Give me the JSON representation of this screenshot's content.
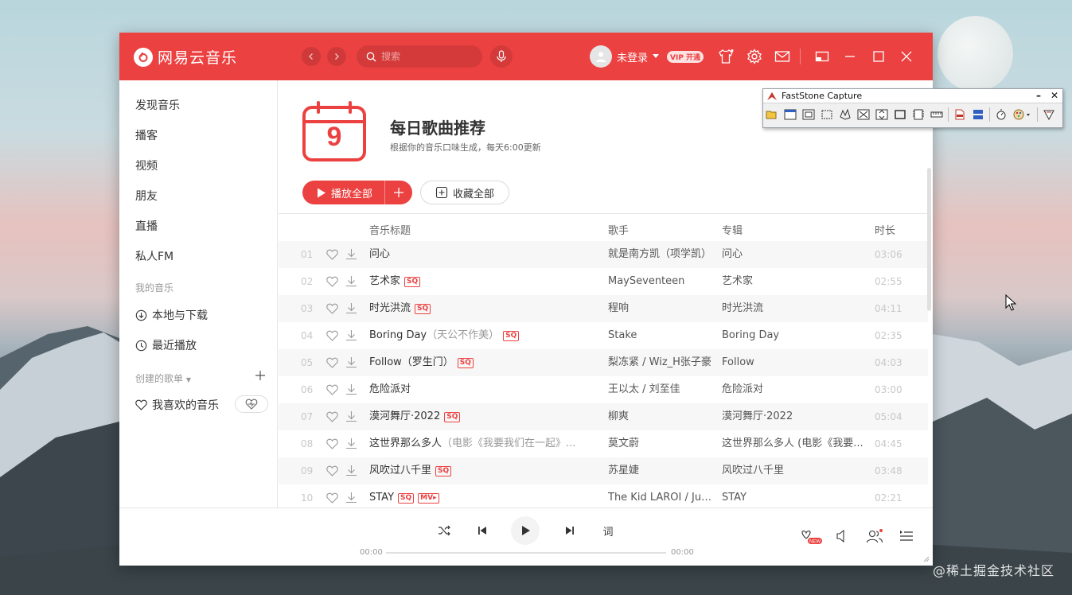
{
  "app": {
    "name": "网易云音乐",
    "search_placeholder": "搜索",
    "user_name": "未登录",
    "vip_label": "VIP 开通"
  },
  "sidebar": {
    "items": [
      "发现音乐",
      "播客",
      "视频",
      "朋友",
      "直播",
      "私人FM"
    ],
    "my_music_header": "我的音乐",
    "my_music_items": [
      "本地与下载",
      "最近播放"
    ],
    "created_header": "创建的歌单",
    "liked_playlist": "我喜欢的音乐"
  },
  "daily": {
    "calendar_day": "9",
    "title": "每日歌曲推荐",
    "subtitle": "根据你的音乐口味生成，每天6:00更新",
    "play_all": "播放全部",
    "collect_all": "收藏全部"
  },
  "table": {
    "headers": {
      "title": "音乐标题",
      "artist": "歌手",
      "album": "专辑",
      "duration": "时长"
    },
    "rows": [
      {
        "idx": "01",
        "title": "问心",
        "alias": "",
        "sq": false,
        "mv": false,
        "artist": "就是南方凯（项学凯）",
        "album": "问心",
        "duration": "03:06"
      },
      {
        "idx": "02",
        "title": "艺术家",
        "alias": "",
        "sq": true,
        "mv": false,
        "artist": "MaySeventeen",
        "album": "艺术家",
        "duration": "02:55"
      },
      {
        "idx": "03",
        "title": "时光洪流",
        "alias": "",
        "sq": true,
        "mv": false,
        "artist": "程响",
        "album": "时光洪流",
        "duration": "04:11"
      },
      {
        "idx": "04",
        "title": "Boring Day",
        "alias": "（天公不作美）",
        "sq": true,
        "mv": false,
        "artist": "Stake",
        "album": "Boring Day",
        "duration": "02:35"
      },
      {
        "idx": "05",
        "title": "Follow（罗生门）",
        "alias": "",
        "sq": true,
        "mv": false,
        "artist": "梨冻紧 / Wiz_H张子豪",
        "album": "Follow",
        "duration": "04:03"
      },
      {
        "idx": "06",
        "title": "危险派对",
        "alias": "",
        "sq": false,
        "mv": false,
        "artist": "王以太 / 刘至佳",
        "album": "危险派对",
        "duration": "03:00"
      },
      {
        "idx": "07",
        "title": "漠河舞厅·2022",
        "alias": "",
        "sq": true,
        "mv": false,
        "artist": "柳爽",
        "album": "漠河舞厅·2022",
        "duration": "05:04"
      },
      {
        "idx": "08",
        "title": "这世界那么多人",
        "alias": "（电影《我要我们在一起》...",
        "sq": false,
        "mv": true,
        "artist": "莫文蔚",
        "album": "这世界那么多人 (电影《我要...",
        "duration": "04:45"
      },
      {
        "idx": "09",
        "title": "风吹过八千里",
        "alias": "",
        "sq": true,
        "mv": false,
        "artist": "苏星婕",
        "album": "风吹过八千里",
        "duration": "03:48"
      },
      {
        "idx": "10",
        "title": "STAY",
        "alias": "",
        "sq": true,
        "mv": true,
        "artist": "The Kid LAROI / Just...",
        "album": "STAY",
        "duration": "02:21"
      }
    ],
    "sq_label": "SQ",
    "mv_label": "MV▸"
  },
  "player": {
    "lyric_label": "词",
    "time_current": "00:00",
    "time_total": "00:00",
    "progress": 0
  },
  "faststone": {
    "title": "FastStone Capture"
  },
  "watermark": "@稀土掘金技术社区",
  "colors": {
    "brand": "#ec4141",
    "row_alt": "#f7f7f7",
    "muted": "#999999"
  }
}
